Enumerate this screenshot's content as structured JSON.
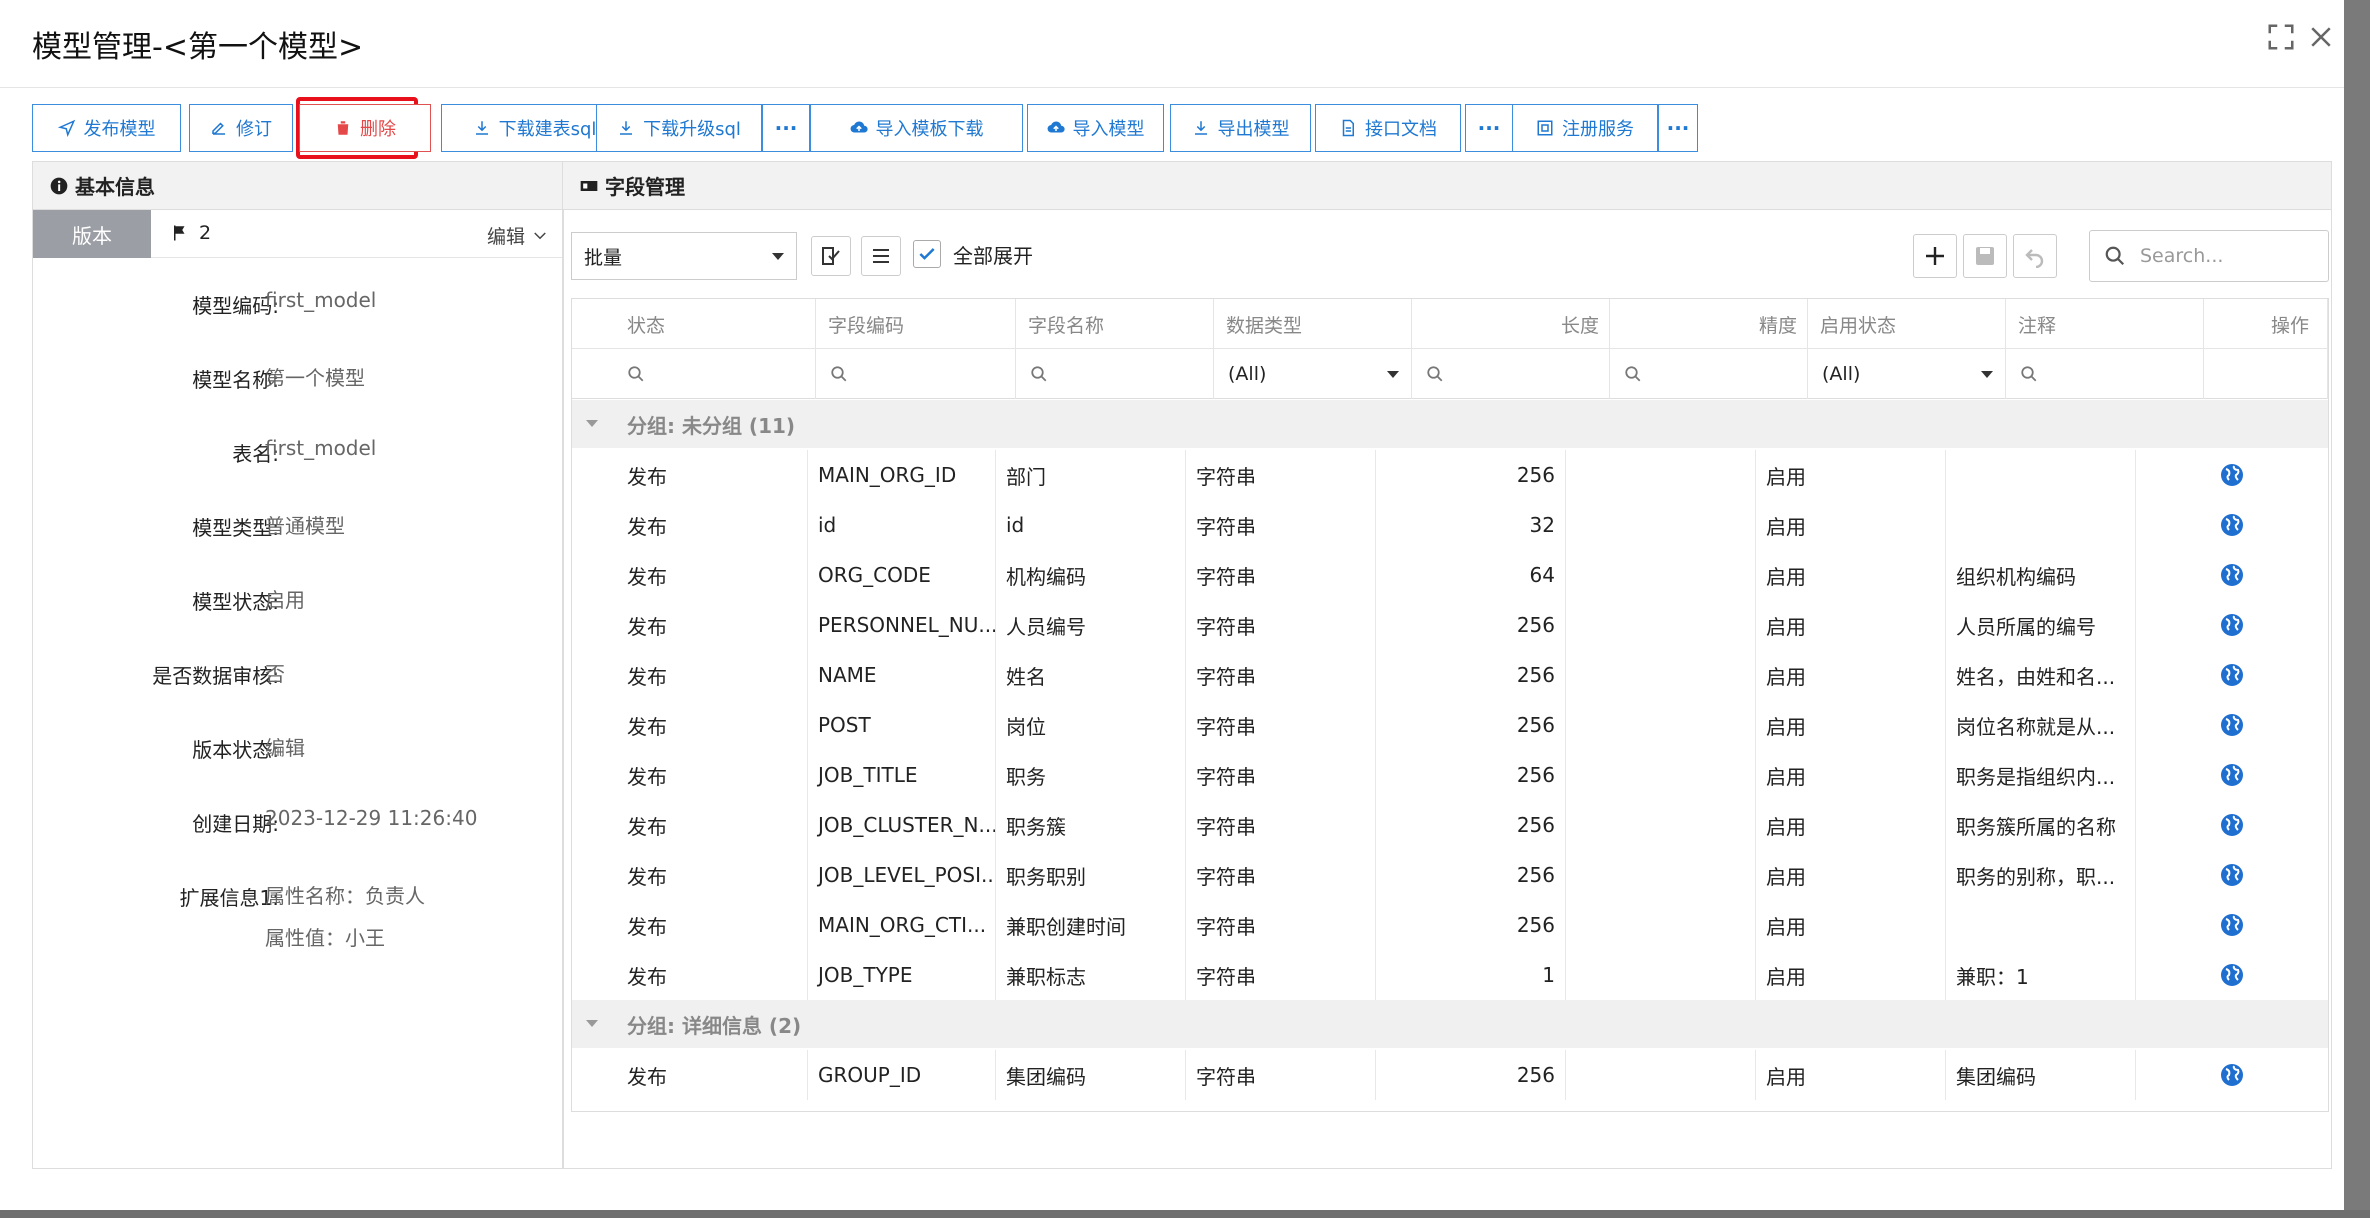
{
  "dialog": {
    "title": "模型管理-<第一个模型>"
  },
  "toolbar": {
    "buttons": [
      {
        "label": "发布模型",
        "icon": "send-icon"
      },
      {
        "label": "修订",
        "icon": "edit-icon"
      },
      {
        "label": "删除",
        "icon": "trash-icon"
      },
      {
        "label": "下载建表sql",
        "icon": "download-icon"
      },
      {
        "label": "下载升级sql",
        "icon": "download-icon"
      },
      {
        "label": "···",
        "icon": "more-icon"
      },
      {
        "label": "导入模板下载",
        "icon": "cloud-upload-icon"
      },
      {
        "label": "导入模型",
        "icon": "cloud-upload-icon"
      },
      {
        "label": "导出模型",
        "icon": "download-icon"
      },
      {
        "label": "接口文档",
        "icon": "document-icon"
      },
      {
        "label": "···",
        "icon": "more-icon"
      },
      {
        "label": "注册服务",
        "icon": "register-icon"
      },
      {
        "label": "···",
        "icon": "more-icon"
      }
    ]
  },
  "basic_info": {
    "title": "基本信息",
    "version_tab": "版本",
    "version_number": "2",
    "edit_label": "编辑",
    "fields": [
      {
        "label": "模型编码:",
        "value": "first_model"
      },
      {
        "label": "模型名称:",
        "value": "第一个模型"
      },
      {
        "label": "表名:",
        "value": "first_model"
      },
      {
        "label": "模型类型:",
        "value": "普通模型"
      },
      {
        "label": "模型状态:",
        "value": "启用"
      },
      {
        "label": "是否数据审核:",
        "value": "否"
      },
      {
        "label": "版本状态:",
        "value": "编辑"
      },
      {
        "label": "创建日期:",
        "value": "2023-12-29 11:26:40"
      },
      {
        "label": "扩展信息1:",
        "value": "属性名称：负责人",
        "value2": "属性值：小王"
      }
    ]
  },
  "field_mgmt": {
    "title": "字段管理",
    "batch_select": "批量",
    "expand_all": "全部展开",
    "search_placeholder": "Search...",
    "columns": [
      "状态",
      "字段编码",
      "字段名称",
      "数据类型",
      "长度",
      "精度",
      "启用状态",
      "注释",
      "操作"
    ],
    "filter_all": "(All)",
    "groups": [
      {
        "title": "分组: 未分组 (11)",
        "rows": [
          [
            "发布",
            "MAIN_ORG_ID",
            "部门",
            "字符串",
            "256",
            "",
            "启用",
            ""
          ],
          [
            "发布",
            "id",
            "id",
            "字符串",
            "32",
            "",
            "启用",
            ""
          ],
          [
            "发布",
            "ORG_CODE",
            "机构编码",
            "字符串",
            "64",
            "",
            "启用",
            "组织机构编码"
          ],
          [
            "发布",
            "PERSONNEL_NU...",
            "人员编号",
            "字符串",
            "256",
            "",
            "启用",
            "人员所属的编号"
          ],
          [
            "发布",
            "NAME",
            "姓名",
            "字符串",
            "256",
            "",
            "启用",
            "姓名，由姓和名..."
          ],
          [
            "发布",
            "POST",
            "岗位",
            "字符串",
            "256",
            "",
            "启用",
            "岗位名称就是从..."
          ],
          [
            "发布",
            "JOB_TITLE",
            "职务",
            "字符串",
            "256",
            "",
            "启用",
            "职务是指组织内..."
          ],
          [
            "发布",
            "JOB_CLUSTER_N...",
            "职务簇",
            "字符串",
            "256",
            "",
            "启用",
            "职务簇所属的名称"
          ],
          [
            "发布",
            "JOB_LEVEL_POSI...",
            "职务职别",
            "字符串",
            "256",
            "",
            "启用",
            "职务的别称，职..."
          ],
          [
            "发布",
            "MAIN_ORG_CTI...",
            "兼职创建时间",
            "字符串",
            "256",
            "",
            "启用",
            ""
          ],
          [
            "发布",
            "JOB_TYPE",
            "兼职标志",
            "字符串",
            "1",
            "",
            "启用",
            "兼职：1"
          ]
        ]
      },
      {
        "title": "分组: 详细信息 (2)",
        "rows": [
          [
            "发布",
            "GROUP_ID",
            "集团编码",
            "字符串",
            "256",
            "",
            "启用",
            "集团编码"
          ]
        ]
      }
    ]
  }
}
